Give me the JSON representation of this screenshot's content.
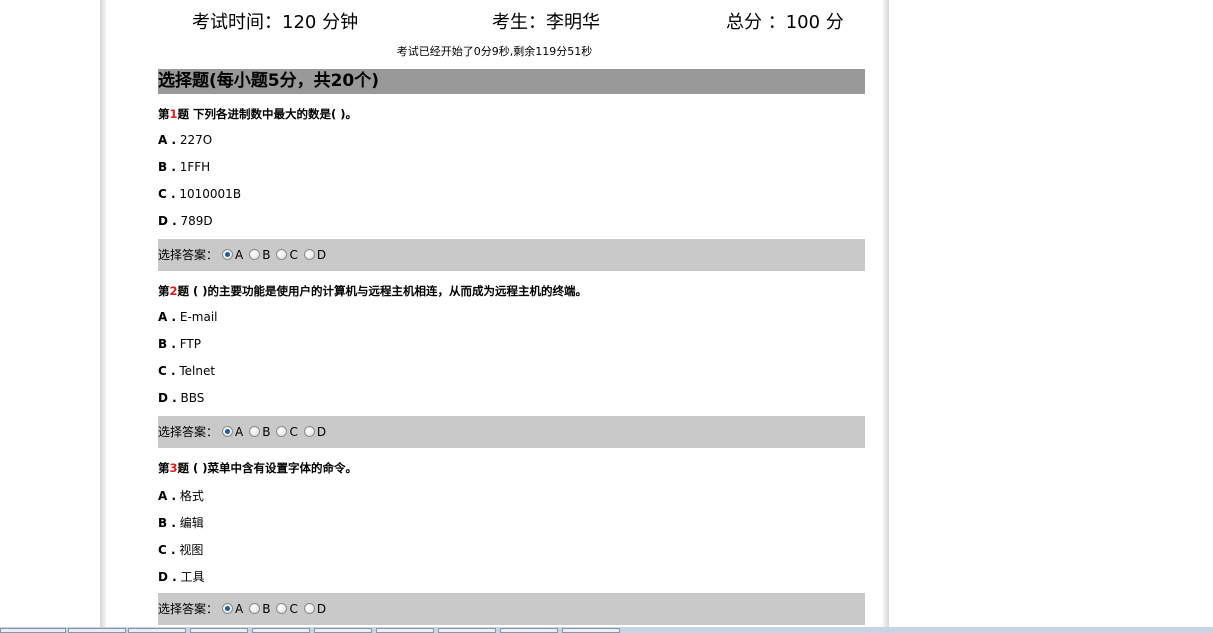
{
  "header": {
    "exam_time": "考试时间：120 分钟",
    "examinee": "考生：李明华",
    "total_score": "总分 ：100 分",
    "timer": "考试已经开始了0分9秒,剩余119分51秒"
  },
  "section": {
    "title": "选择题(每小题5分，共20个)"
  },
  "answer_label": "选择答案：",
  "questions": [
    {
      "prefix": "第",
      "number": "1",
      "text": "题 下列各进制数中最大的数是( )。",
      "options": [
        {
          "letter": "A .",
          "text": "227O"
        },
        {
          "letter": "B .",
          "text": "1FFH"
        },
        {
          "letter": "C .",
          "text": "1010001B"
        },
        {
          "letter": "D .",
          "text": "789D"
        }
      ],
      "choices": [
        "A",
        "B",
        "C",
        "D"
      ],
      "selected": "A"
    },
    {
      "prefix": "第",
      "number": "2",
      "text": "题 ( )的主要功能是使用户的计算机与远程主机相连，从而成为远程主机的终端。",
      "options": [
        {
          "letter": "A .",
          "text": "E-mail"
        },
        {
          "letter": "B .",
          "text": "FTP"
        },
        {
          "letter": "C .",
          "text": "Telnet"
        },
        {
          "letter": "D .",
          "text": "BBS"
        }
      ],
      "choices": [
        "A",
        "B",
        "C",
        "D"
      ],
      "selected": "A"
    },
    {
      "prefix": "第",
      "number": "3",
      "text": "题 ( )菜单中含有设置字体的命令。",
      "options": [
        {
          "letter": "A .",
          "text": "格式"
        },
        {
          "letter": "B .",
          "text": "编辑"
        },
        {
          "letter": "C .",
          "text": "视图"
        },
        {
          "letter": "D .",
          "text": "工具"
        }
      ],
      "choices": [
        "A",
        "B",
        "C",
        "D"
      ],
      "selected": "A"
    }
  ]
}
